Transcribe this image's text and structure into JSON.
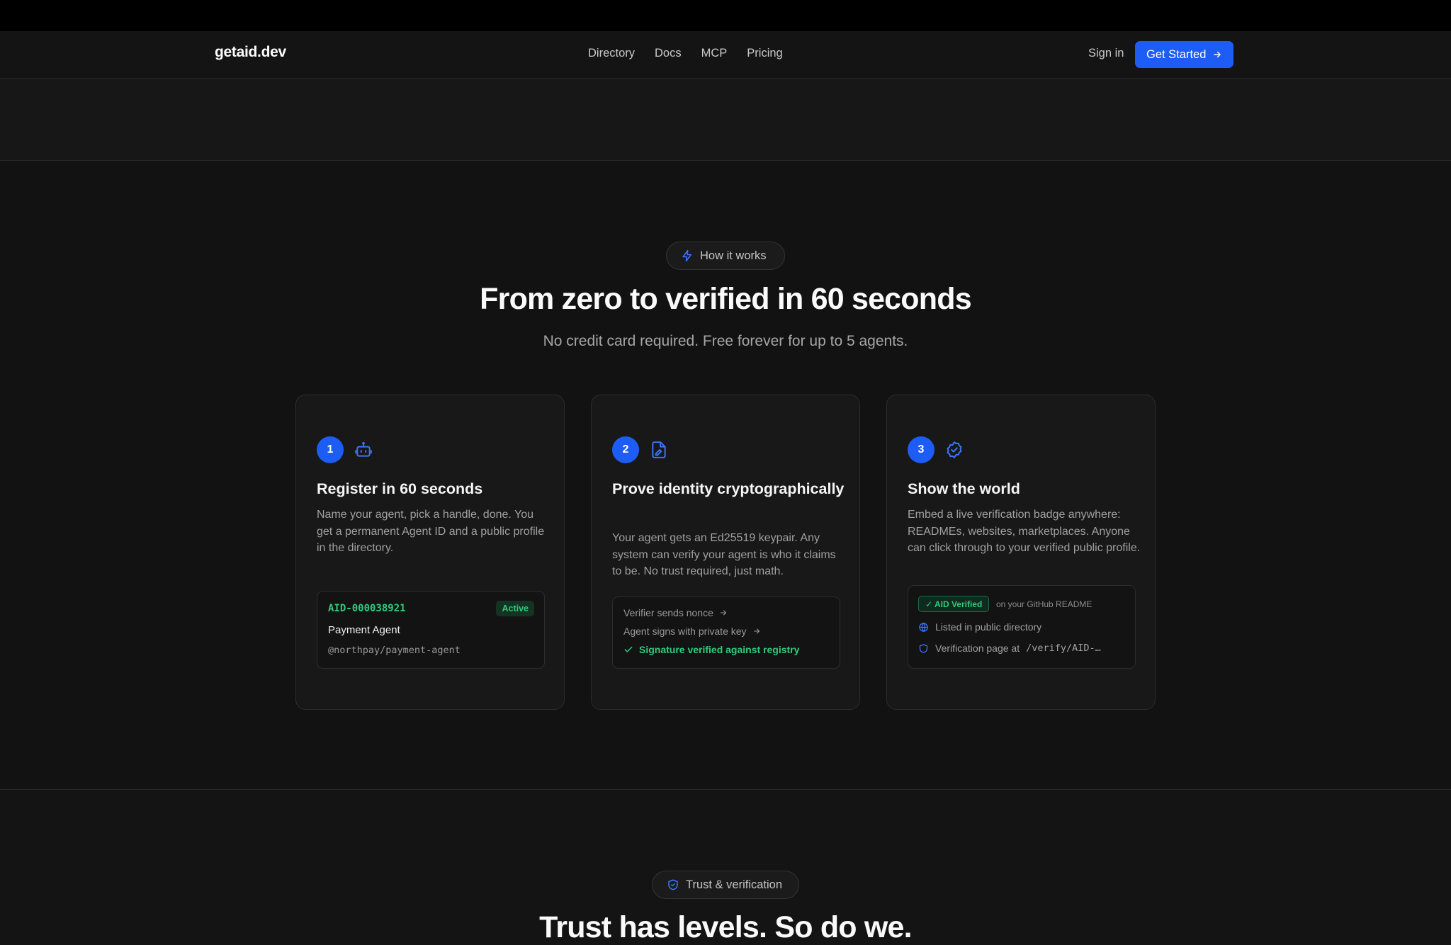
{
  "nav": {
    "logo": "getaid.dev",
    "links": [
      "Directory",
      "Docs",
      "MCP",
      "Pricing"
    ],
    "signin": "Sign in",
    "cta": "Get Started"
  },
  "how": {
    "pill": "How it works",
    "title": "From zero to verified in 60 seconds",
    "subtitle": "No credit card required. Free forever for up to 5 agents.",
    "steps": [
      {
        "num": "1",
        "icon": "bot-icon",
        "title": "Register in 60 seconds",
        "desc": "Name your agent, pick a handle, done. You get a permanent Agent ID and a public profile in the directory.",
        "aid": "AID-000038921",
        "status": "Active",
        "agent_name": "Payment Agent",
        "handle": "@northpay/payment-agent"
      },
      {
        "num": "2",
        "icon": "signed-document-icon",
        "title": "Prove identity cryptographically",
        "desc": "Your agent gets an Ed25519 keypair. Any system can verify your agent is who it claims to be. No trust required, just math.",
        "flow": [
          "Verifier sends nonce",
          "Agent signs with private key",
          "Signature verified against registry"
        ]
      },
      {
        "num": "3",
        "icon": "verified-badge-icon",
        "title": "Show the world",
        "desc": "Embed a live verification badge anywhere: READMEs, websites, marketplaces. Anyone can click through to your verified public profile.",
        "badge": "✓ AID Verified",
        "badge_note": "on your GitHub README",
        "list": [
          "Listed in public directory",
          "Verification page at"
        ],
        "verify_path": "/verify/AID-…"
      }
    ]
  },
  "trust": {
    "pill": "Trust & verification",
    "title": "Trust has levels. So do we."
  },
  "colors": {
    "accent": "#1d5cf5",
    "success": "#2fcb7c",
    "background": "#121212"
  }
}
